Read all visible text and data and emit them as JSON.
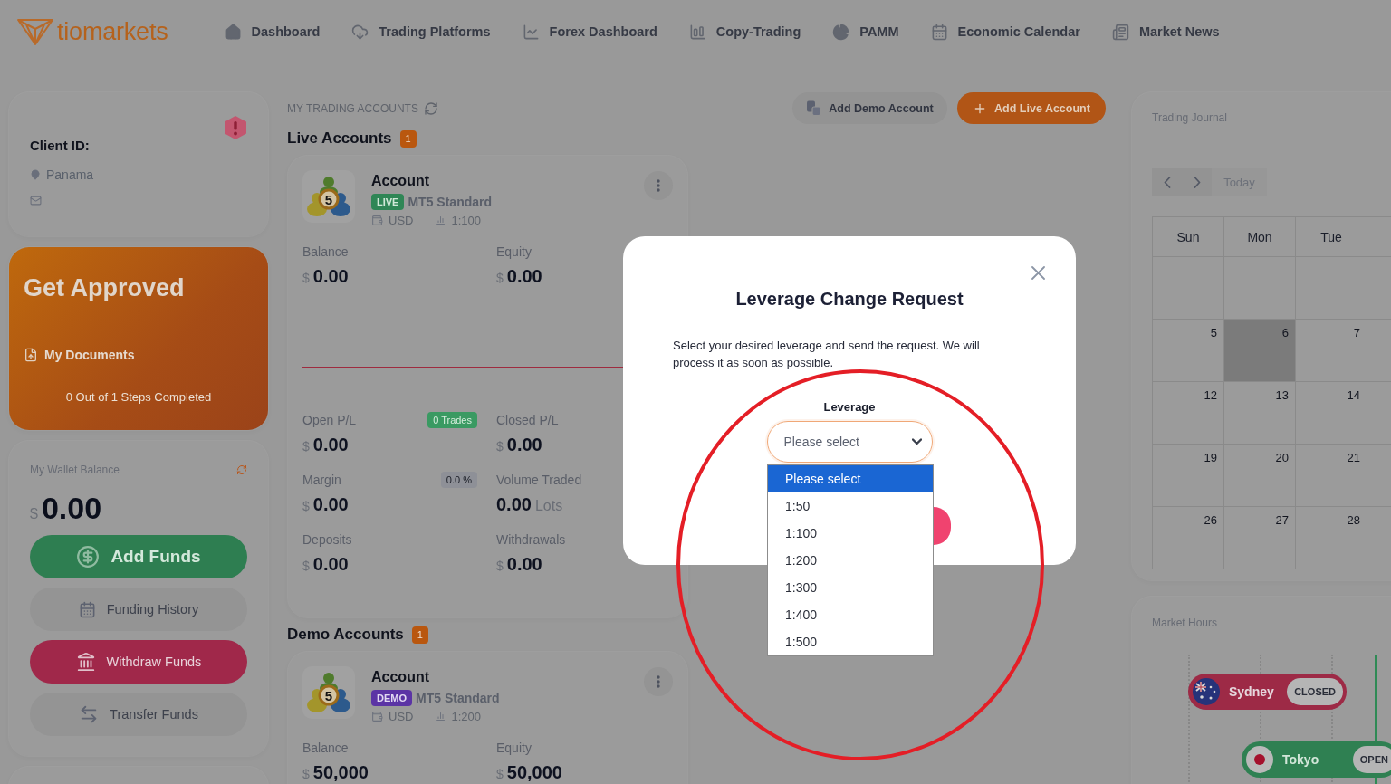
{
  "logo": {
    "text": "tiomarkets"
  },
  "nav": {
    "items": [
      {
        "label": "Dashboard"
      },
      {
        "label": "Trading Platforms"
      },
      {
        "label": "Forex Dashboard"
      },
      {
        "label": "Copy-Trading"
      },
      {
        "label": "PAMM"
      },
      {
        "label": "Economic Calendar"
      },
      {
        "label": "Market News"
      }
    ]
  },
  "profile": {
    "client_label": "Client ID:",
    "location": "Panama"
  },
  "approval": {
    "title": "Get Approved",
    "link": "My Documents",
    "progress": "0 Out of 1 Steps Completed"
  },
  "wallet": {
    "label": "My Wallet Balance",
    "currency": "$",
    "amount": "0.00",
    "actions": [
      {
        "label": "Add Funds",
        "kind": "add"
      },
      {
        "label": "Funding History",
        "kind": "history"
      },
      {
        "label": "Withdraw Funds",
        "kind": "withdraw"
      },
      {
        "label": "Transfer Funds",
        "kind": "transfer"
      }
    ]
  },
  "accounts": {
    "heading": "MY TRADING ACCOUNTS",
    "actions": [
      {
        "label": "Add Demo Account",
        "kind": "demo"
      },
      {
        "label": "Add Live Account",
        "kind": "live"
      }
    ],
    "groups": [
      {
        "title": "Live Accounts",
        "count": "1",
        "account": {
          "name": "Account",
          "kind": "live",
          "type_label": "LIVE",
          "logo_mark": "5",
          "plan": "MT5 Standard",
          "currency": "USD",
          "leverage": "1:100",
          "summary": [
            {
              "label": "Balance",
              "currency": "$",
              "value": "0.00"
            },
            {
              "label": "Equity",
              "currency": "$",
              "value": "0.00"
            }
          ],
          "stats": [
            {
              "label": "Open P/L",
              "badge": {
                "text": "0 Trades",
                "kind": "count"
              },
              "currency": "$",
              "value": "0.00"
            },
            {
              "label": "Closed P/L",
              "currency": "$",
              "value": "0.00"
            },
            {
              "label": "Margin",
              "badge": {
                "text": "0.0 %",
                "kind": "percent"
              },
              "currency": "$",
              "value": "0.00"
            },
            {
              "label": "Volume Traded",
              "value": "0.00",
              "unit": "Lots"
            },
            {
              "label": "Deposits",
              "currency": "$",
              "value": "0.00"
            },
            {
              "label": "Withdrawals",
              "currency": "$",
              "value": "0.00"
            }
          ]
        }
      },
      {
        "title": "Demo Accounts",
        "count": "1",
        "account": {
          "name": "Account",
          "kind": "demo",
          "type_label": "DEMO",
          "logo_mark": "5",
          "plan": "MT5 Standard",
          "currency": "USD",
          "leverage": "1:200",
          "summary": [
            {
              "label": "Balance",
              "currency": "$",
              "value": "50,000"
            },
            {
              "label": "Equity",
              "currency": "$",
              "value": "50,000"
            }
          ]
        }
      }
    ]
  },
  "journal": {
    "title": "Trading Journal",
    "today_label": "Today",
    "weekdays": [
      "Sun",
      "Mon",
      "Tue"
    ],
    "weeks": [
      [
        {
          "today": false
        },
        {
          "today": false
        },
        {
          "today": false
        }
      ],
      [
        {
          "day": "5",
          "today": false
        },
        {
          "day": "6",
          "today": true
        },
        {
          "day": "7",
          "today": false
        }
      ],
      [
        {
          "day": "12",
          "today": false
        },
        {
          "day": "13",
          "today": false
        },
        {
          "day": "14",
          "today": false
        }
      ],
      [
        {
          "day": "19",
          "today": false
        },
        {
          "day": "20",
          "today": false
        },
        {
          "day": "21",
          "today": false
        }
      ],
      [
        {
          "day": "26",
          "today": false
        },
        {
          "day": "27",
          "today": false
        },
        {
          "day": "28",
          "today": false
        }
      ]
    ]
  },
  "market": {
    "title": "Market Hours",
    "sessions": [
      {
        "city": "Sydney",
        "status": "CLOSED",
        "open": false,
        "kind": "australia"
      },
      {
        "city": "Tokyo",
        "status": "OPEN",
        "open": true,
        "kind": "japan"
      }
    ]
  },
  "modal": {
    "title": "Leverage Change Request",
    "message": "Select your desired leverage and send the request. We will process it as soon as possible.",
    "field_label": "Leverage",
    "select": {
      "value": "Please select",
      "expanded": true,
      "options": [
        {
          "label": "Please select",
          "selected": true
        },
        {
          "label": "1:50",
          "selected": false
        },
        {
          "label": "1:100",
          "selected": false
        },
        {
          "label": "1:200",
          "selected": false
        },
        {
          "label": "1:300",
          "selected": false
        },
        {
          "label": "1:400",
          "selected": false
        },
        {
          "label": "1:500",
          "selected": false
        }
      ]
    }
  }
}
